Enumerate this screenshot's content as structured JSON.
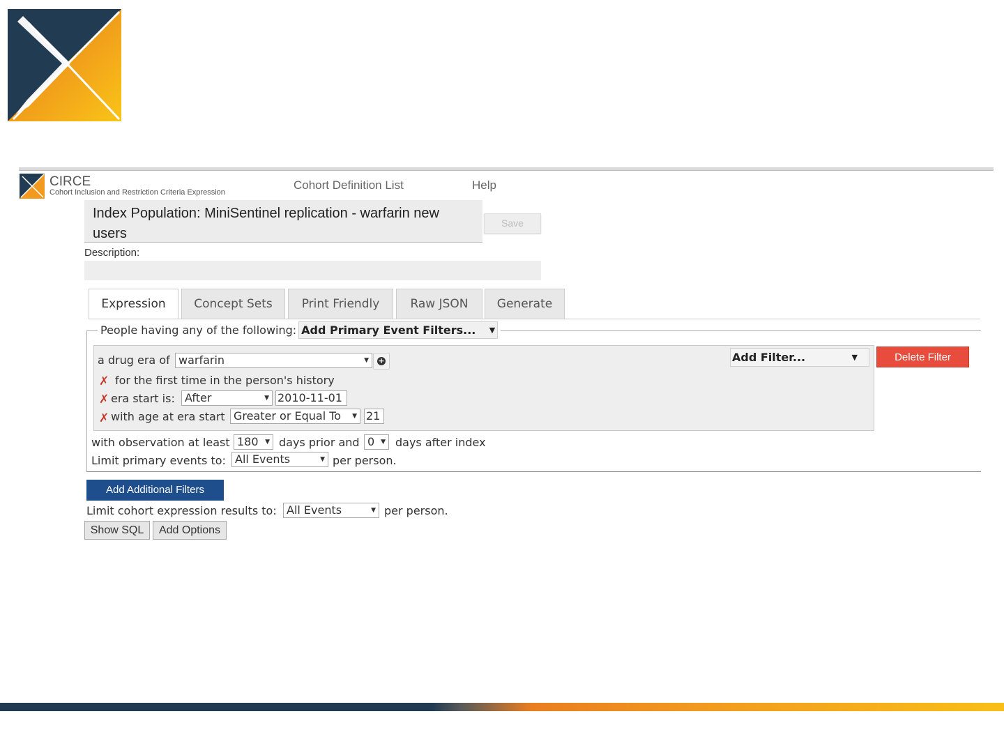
{
  "header": {
    "brand_name": "CIRCE",
    "brand_subtitle": "Cohort Inclusion and Restriction Criteria Expression",
    "nav": [
      "Cohort Definition List",
      "Help"
    ]
  },
  "cohort": {
    "title": "Index Population: MiniSentinel replication - warfarin new users",
    "save_label": "Save",
    "description_label": "Description:",
    "description_value": ""
  },
  "tabs": [
    {
      "label": "Expression",
      "active": true
    },
    {
      "label": "Concept Sets",
      "active": false
    },
    {
      "label": "Print Friendly",
      "active": false
    },
    {
      "label": "Raw JSON",
      "active": false
    },
    {
      "label": "Generate",
      "active": false
    }
  ],
  "primary": {
    "legend_text": "People having any of the following:",
    "add_primary_label": "Add Primary Event Filters...",
    "criteria": {
      "prefix": "a drug era of",
      "concept_value": "warfarin",
      "first_time_text": "for the first time in the person's history",
      "era_start_label": "era start is:",
      "era_start_op": "After",
      "era_start_date": "2010-11-01",
      "age_label": "with age at era start",
      "age_op": "Greater or Equal To",
      "age_value": "21",
      "add_filter_label": "Add Filter...",
      "delete_filter_label": "Delete Filter"
    },
    "observation": {
      "prefix": "with observation at least",
      "prior_value": "180",
      "prior_suffix": "days prior and",
      "after_value": "0",
      "after_suffix": "days after index"
    },
    "limit": {
      "label": "Limit primary events to:",
      "value": "All Events",
      "suffix": "per person."
    }
  },
  "additional_filters_label": "Add Additional Filters",
  "result_limit": {
    "label": "Limit cohort expression results to:",
    "value": "All Events",
    "suffix": "per person."
  },
  "actions": {
    "show_sql": "Show SQL",
    "add_options": "Add Options"
  },
  "colors": {
    "navy": "#213b53",
    "orange": "#f29a1f",
    "danger": "#e74c3c",
    "primary_button": "#1f4e8c"
  },
  "icons": {
    "delete_criteria": "x-mark-icon",
    "add_concept": "plus-circle-icon",
    "dropdown": "caret-down-icon"
  }
}
